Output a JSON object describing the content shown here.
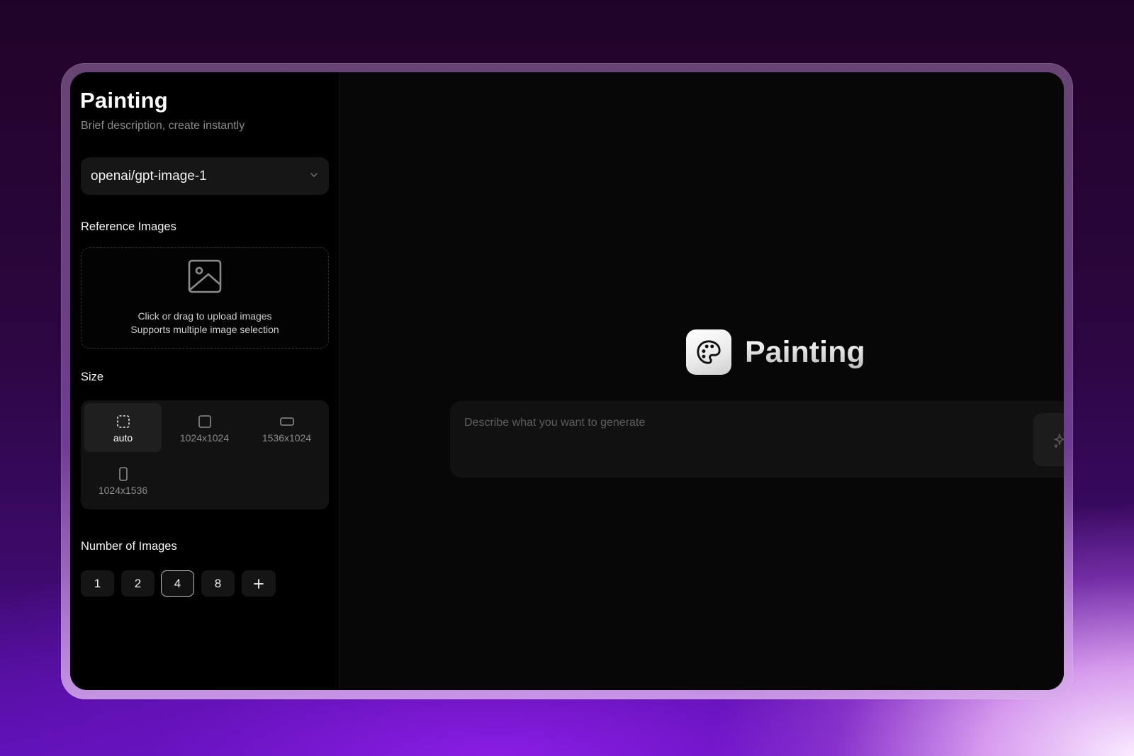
{
  "sidebar": {
    "title": "Painting",
    "subtitle": "Brief description, create instantly",
    "model": {
      "selected": "openai/gpt-image-1",
      "icon": "chevron-down-icon"
    },
    "reference_images": {
      "label": "Reference Images",
      "upload_line1": "Click or drag to upload images",
      "upload_line2": "Supports multiple image selection",
      "icon": "image-icon"
    },
    "size": {
      "label": "Size",
      "selected": "auto",
      "options": [
        {
          "label": "auto",
          "icon": "dashed-square-icon"
        },
        {
          "label": "1024x1024",
          "icon": "square-icon"
        },
        {
          "label": "1536x1024",
          "icon": "landscape-rect-icon"
        },
        {
          "label": "1024x1536",
          "icon": "portrait-rect-icon"
        }
      ]
    },
    "number_of_images": {
      "label": "Number of Images",
      "selected": "4",
      "options": [
        "1",
        "2",
        "4",
        "8",
        "+"
      ]
    }
  },
  "main": {
    "hero_title": "Painting",
    "hero_icon": "palette-icon",
    "prompt_placeholder": "Describe what you want to generate",
    "generate_icon": "sparkles-icon"
  },
  "colors": {
    "window_bg": "#000000",
    "panel_bg": "#121212",
    "text_primary": "#f2f2f2",
    "text_muted": "#8a8a8a",
    "background_purple": "#5a10b0"
  }
}
